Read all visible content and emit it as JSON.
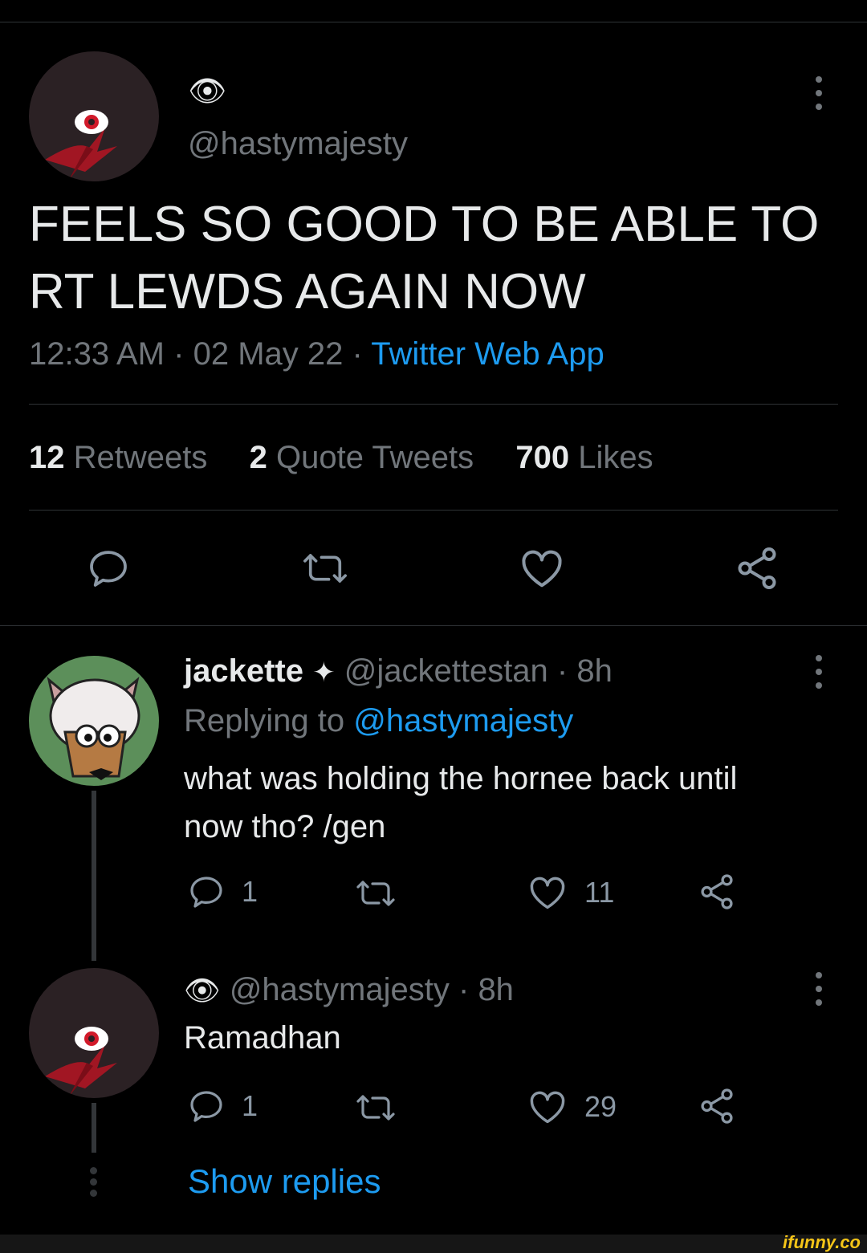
{
  "main_tweet": {
    "display_emoji": "👁",
    "handle": "@hastymajesty",
    "text_line1": "FEELS SO GOOD TO BE ABLE TO",
    "text_line2": "RT LEWDS AGAIN NOW",
    "time": "12:33 AM",
    "date": "02 May 22",
    "source": "Twitter Web App",
    "retweets_count": "12",
    "retweets_label": "Retweets",
    "quotes_count": "2",
    "quotes_label": "Quote Tweets",
    "likes_count": "700",
    "likes_label": "Likes"
  },
  "reply1": {
    "name": "jackette",
    "badge": "✦",
    "handle": "@jackettestan",
    "age": "8h",
    "replying_prefix": "Replying to",
    "replying_handle": "@hastymajesty",
    "text_line1": "what was holding the hornee back until",
    "text_line2": "now tho? /gen",
    "reply_count": "1",
    "like_count": "11"
  },
  "reply2": {
    "display_emoji": "👁",
    "handle": "@hastymajesty",
    "age": "8h",
    "text": "Ramadhan",
    "reply_count": "1",
    "like_count": "29"
  },
  "show_replies": "Show replies",
  "separator": "·",
  "watermark": "ifunny.co",
  "colors": {
    "background": "#000000",
    "accent": "#1d9bf0",
    "muted": "#71767b",
    "divider": "#2f3336"
  }
}
